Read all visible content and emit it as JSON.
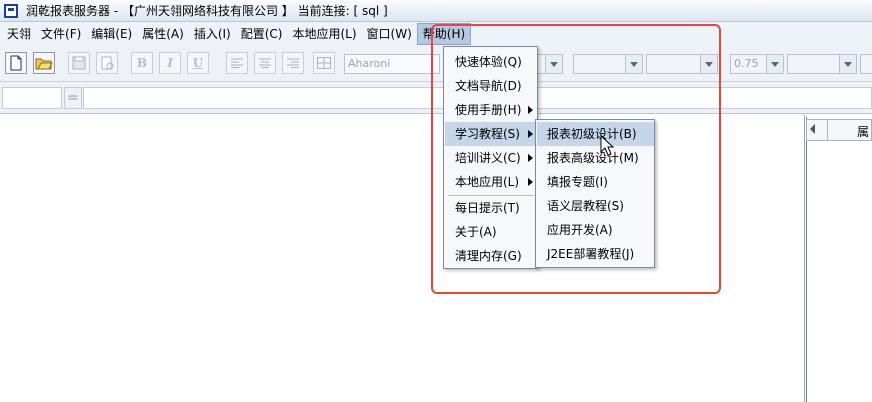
{
  "title_bar": {
    "text": "润乾报表服务器 - 【广州天翎网络科技有限公司 】  当前连接: [ sql ]"
  },
  "menu_bar": [
    {
      "label": "天翎"
    },
    {
      "label": "文件(F)"
    },
    {
      "label": "编辑(E)"
    },
    {
      "label": "属性(A)"
    },
    {
      "label": "插入(I)"
    },
    {
      "label": "配置(C)"
    },
    {
      "label": "本地应用(L)"
    },
    {
      "label": "窗口(W)"
    },
    {
      "label": "帮助(H)"
    }
  ],
  "toolbar": {
    "font_name": "Aharoni",
    "zoom": "0.75"
  },
  "help_menu": [
    {
      "label": "快速体验(Q)"
    },
    {
      "label": "文档导航(D)"
    },
    {
      "label": "使用手册(H)"
    },
    {
      "label": "学习教程(S)"
    },
    {
      "label": "培训讲义(C)"
    },
    {
      "label": "本地应用(L)"
    },
    {
      "label": "每日提示(T)"
    },
    {
      "label": "关于(A)"
    },
    {
      "label": "清理内存(G)"
    }
  ],
  "tutorial_submenu": [
    {
      "label": "报表初级设计(B)"
    },
    {
      "label": "报表高级设计(M)"
    },
    {
      "label": "填报专题(I)"
    },
    {
      "label": "语义层教程(S)"
    },
    {
      "label": "应用开发(A)"
    },
    {
      "label": "J2EE部署教程(J)"
    }
  ],
  "right_panel": {
    "title": "属"
  },
  "colors": {
    "highlight": "#e8453c",
    "menu_highlight": "#c5d5ea"
  }
}
